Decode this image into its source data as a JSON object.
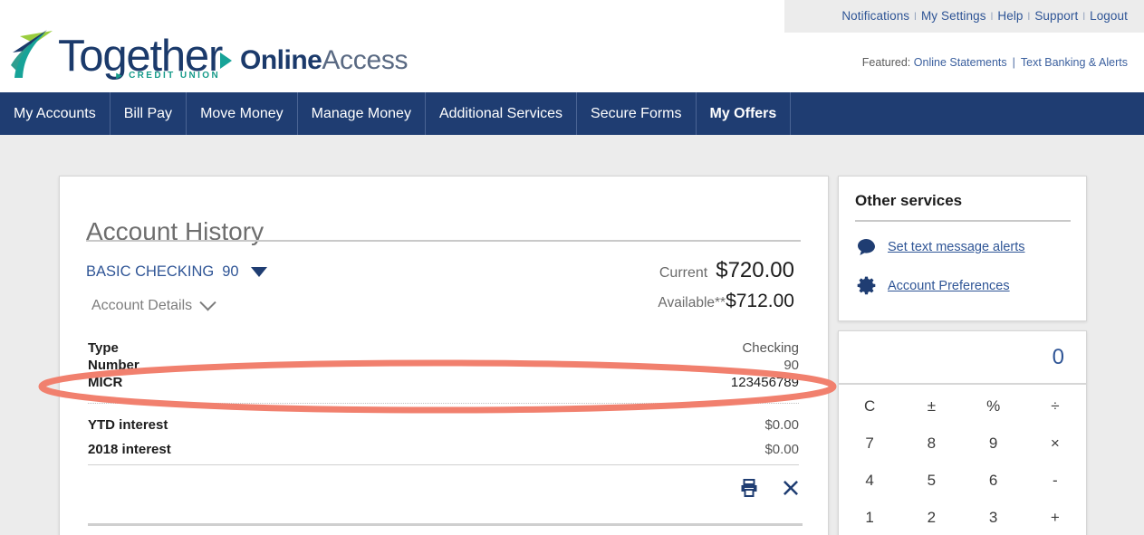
{
  "utility": {
    "links": [
      "Notifications",
      "My Settings",
      "Help",
      "Support",
      "Logout"
    ],
    "separator": "l"
  },
  "featured": {
    "label": "Featured:",
    "links": [
      "Online Statements",
      "Text Banking & Alerts"
    ],
    "separator": "|"
  },
  "brand": {
    "wordmark": "Together",
    "tagline": "CREDIT UNION",
    "product_bold": "Online",
    "product_light": "Access",
    "navy": "#1b3a6b",
    "teal": "#17a398",
    "green": "#9acd3e"
  },
  "mainnav": {
    "items": [
      {
        "label": "My Accounts",
        "active": false
      },
      {
        "label": "Bill Pay",
        "active": false
      },
      {
        "label": "Move Money",
        "active": false
      },
      {
        "label": "Manage Money",
        "active": false
      },
      {
        "label": "Additional Services",
        "active": false
      },
      {
        "label": "Secure Forms",
        "active": false
      },
      {
        "label": "My Offers",
        "active": true
      }
    ],
    "bg": "#1f3d72"
  },
  "account_history": {
    "title": "Account History",
    "account_name": "BASIC CHECKING",
    "account_number": "90",
    "details_toggle": "Account Details",
    "current_label": "Current",
    "current_amount": "$720.00",
    "available_label": "Available**",
    "available_amount": "$712.00",
    "rows": [
      {
        "key": "Type",
        "value": "Checking"
      },
      {
        "key": "Number",
        "value": "90"
      },
      {
        "key": "MICR",
        "value": "123456789"
      }
    ],
    "interest_rows": [
      {
        "key": "YTD interest",
        "value": "$0.00"
      },
      {
        "key": "2018 interest",
        "value": "$0.00"
      }
    ],
    "actions": [
      "print-icon",
      "close-icon"
    ]
  },
  "other_services": {
    "title": "Other services",
    "items": [
      {
        "label": "Set text message alerts",
        "icon": "chat-bubble-icon"
      },
      {
        "label": "Account Preferences",
        "icon": "gear-icon"
      }
    ]
  },
  "calculator": {
    "display": "0",
    "keys": [
      "C",
      "±",
      "%",
      "÷",
      "7",
      "8",
      "9",
      "×",
      "4",
      "5",
      "6",
      "-",
      "1",
      "2",
      "3",
      "+"
    ]
  },
  "annotation": {
    "shape": "ellipse",
    "color": "#F1806E",
    "targets": "MICR row"
  }
}
